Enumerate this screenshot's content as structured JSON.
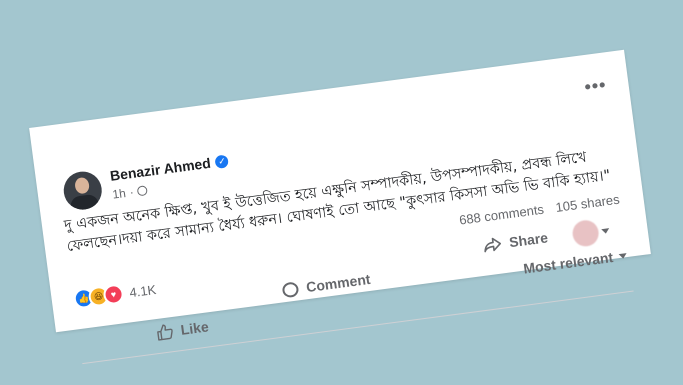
{
  "post": {
    "author": "Benazir Ahmed",
    "time": "1h",
    "more": "•••",
    "text": "দু একজন অনেক ক্ষিপ্ত, খুব ই উত্তেজিত হয়ে এক্ষুনি সম্পাদকীয়, উপসম্পাদকীয়, প্রবন্ধ লিখে ফেলছেন।দয়া করে সামান্য ধৈর্য্য ধরুন। ঘোষণাই তো আছে \"কুৎসার কিসসা অভি ভি বাকি হ্যায়।\"",
    "comments": "688 comments",
    "shares": "105 shares",
    "reactions_count": "4.1K"
  },
  "actions": {
    "like": "Like",
    "comment": "Comment",
    "share": "Share",
    "sort": "Most relevant"
  },
  "colors": {
    "background": "#a3c6cf",
    "like_blue": "#1877f2",
    "love_red": "#f33e58",
    "haha_yellow": "#f7b125"
  }
}
